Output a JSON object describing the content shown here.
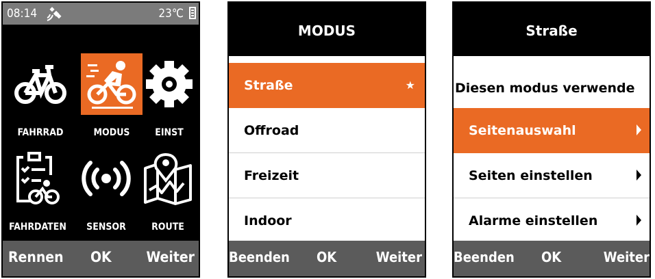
{
  "screen1": {
    "status": {
      "time": "08:14",
      "temperature": "23℃",
      "icons": [
        "satellite-icon",
        "battery-icon"
      ]
    },
    "tiles": [
      {
        "label": "FAHRRAD",
        "icon": "bicycle-icon"
      },
      {
        "label": "MODUS",
        "icon": "cyclist-icon",
        "selected": true
      },
      {
        "label": "EINST",
        "icon": "gear-icon"
      },
      {
        "label": "FAHRDATEN",
        "icon": "clipboard-cyclist-icon"
      },
      {
        "label": "SENSOR",
        "icon": "sensor-signal-icon"
      },
      {
        "label": "ROUTE",
        "icon": "map-pin-icon"
      }
    ],
    "softkeys": {
      "left": "Rennen",
      "center": "OK",
      "right": "Weiter"
    }
  },
  "screen2": {
    "title": "MODUS",
    "items": [
      {
        "label": "Straße",
        "marker": "★",
        "active": true
      },
      {
        "label": "Offroad"
      },
      {
        "label": "Freizeit"
      },
      {
        "label": "Indoor"
      }
    ],
    "softkeys": {
      "left": "Beenden",
      "center": "OK",
      "right": "Weiter"
    }
  },
  "screen3": {
    "title": "Straße",
    "items": [
      {
        "label": "Diesen modus verwende"
      },
      {
        "label": "Seitenauswahl",
        "active": true
      },
      {
        "label": "Seiten einstellen"
      },
      {
        "label": "Alarme einstellen"
      }
    ],
    "softkeys": {
      "left": "Beenden",
      "center": "OK",
      "right": "Weiter"
    }
  },
  "colors": {
    "accent": "#ea6a24",
    "statusbar": "#7b7b7b",
    "softkeys": "#5b5b5b",
    "background": "#000000"
  }
}
